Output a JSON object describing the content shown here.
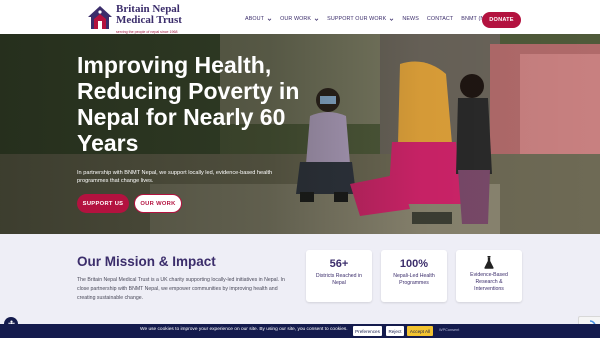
{
  "brand": {
    "line1": "Britain Nepal",
    "line2": "Medical Trust",
    "tagline": "serving the people of nepal since 1968",
    "colors": {
      "primary": "#3b2d6b",
      "accent": "#b3123f"
    }
  },
  "nav": {
    "items": [
      {
        "label": "ABOUT",
        "has_dropdown": true
      },
      {
        "label": "OUR WORK",
        "has_dropdown": true
      },
      {
        "label": "SUPPORT OUR WORK",
        "has_dropdown": true
      },
      {
        "label": "NEWS",
        "has_dropdown": false
      },
      {
        "label": "CONTACT",
        "has_dropdown": false
      },
      {
        "label": "BNMT (NEPAL)",
        "has_dropdown": false
      }
    ],
    "donate_label": "DONATE"
  },
  "hero": {
    "title": "Improving Health, Reducing Poverty in Nepal for Nearly 60 Years",
    "subtitle": "In partnership with BNMT Nepal, we support locally led, evidence-based health programmes that change lives.",
    "primary_button": "SUPPORT US",
    "secondary_button": "OUR WORK"
  },
  "mission": {
    "title": "Our Mission & Impact",
    "text": "The Britain Nepal Medical Trust is a UK charity supporting locally-led initiatives in Nepal. In close partnership with BNMT Nepal, we empower communities by improving health and creating sustainable change.",
    "stats": [
      {
        "value": "56+",
        "label": "Districts Reached in Nepal"
      },
      {
        "value": "100%",
        "label": "Nepali-Led Health Programmes"
      },
      {
        "icon": "flask-icon",
        "label": "Evidence-Based Research & Interventions"
      }
    ]
  },
  "cookie": {
    "message": "We use cookies to improve your experience on our site. By using our site, you consent to cookies.",
    "preferences": "Preferences",
    "reject": "Reject",
    "accept": "Accept All",
    "brand": "WPConsent"
  }
}
